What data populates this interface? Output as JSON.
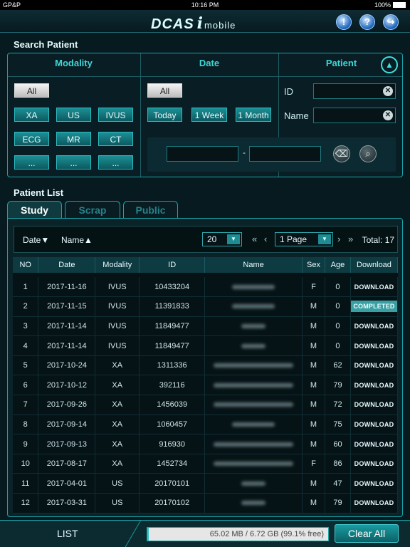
{
  "status": {
    "carrier": "GP&P",
    "time": "10:16 PM",
    "battery": "100%"
  },
  "header": {
    "logo": "DCAS",
    "logo_i": "i",
    "logo_mobile": "mobile",
    "buttons": [
      {
        "icon": "alert-icon",
        "glyph": "!"
      },
      {
        "icon": "help-icon",
        "glyph": "?"
      },
      {
        "icon": "logout-icon",
        "glyph": "↪"
      }
    ]
  },
  "search": {
    "title": "Search Patient",
    "modality": {
      "header": "Modality",
      "all": "All",
      "buttons": [
        "XA",
        "US",
        "IVUS",
        "ECG",
        "MR",
        "CT",
        "...",
        "...",
        "..."
      ]
    },
    "date": {
      "header": "Date",
      "all": "All",
      "buttons": [
        "Today",
        "1 Week",
        "1 Month"
      ],
      "range_sep": "-",
      "range_from": "",
      "range_to": ""
    },
    "patient": {
      "header": "Patient",
      "id_label": "ID",
      "name_label": "Name",
      "id_value": "",
      "name_value": ""
    }
  },
  "list": {
    "title": "Patient List",
    "tabs": [
      "Study",
      "Scrap",
      "Public"
    ],
    "sort_date": "Date▼",
    "sort_name": "Name▲",
    "page_size": "20",
    "page": "1 Page",
    "total": "Total: 17",
    "columns": [
      "NO",
      "Date",
      "Modality",
      "ID",
      "Name",
      "Sex",
      "Age",
      "Download"
    ],
    "rows": [
      {
        "no": "1",
        "date": "2017-11-16",
        "modality": "IVUS",
        "id": "10433204",
        "sex": "F",
        "age": "0",
        "download": "DOWNLOAD"
      },
      {
        "no": "2",
        "date": "2017-11-15",
        "modality": "IVUS",
        "id": "11391833",
        "sex": "M",
        "age": "0",
        "download": "COMPLETED"
      },
      {
        "no": "3",
        "date": "2017-11-14",
        "modality": "IVUS",
        "id": "11849477",
        "sex": "M",
        "age": "0",
        "download": "DOWNLOAD"
      },
      {
        "no": "4",
        "date": "2017-11-14",
        "modality": "IVUS",
        "id": "11849477",
        "sex": "M",
        "age": "0",
        "download": "DOWNLOAD"
      },
      {
        "no": "5",
        "date": "2017-10-24",
        "modality": "XA",
        "id": "1311336",
        "sex": "M",
        "age": "62",
        "download": "DOWNLOAD"
      },
      {
        "no": "6",
        "date": "2017-10-12",
        "modality": "XA",
        "id": "392116",
        "sex": "M",
        "age": "79",
        "download": "DOWNLOAD"
      },
      {
        "no": "7",
        "date": "2017-09-26",
        "modality": "XA",
        "id": "1456039",
        "sex": "M",
        "age": "72",
        "download": "DOWNLOAD"
      },
      {
        "no": "8",
        "date": "2017-09-14",
        "modality": "XA",
        "id": "1060457",
        "sex": "M",
        "age": "75",
        "download": "DOWNLOAD"
      },
      {
        "no": "9",
        "date": "2017-09-13",
        "modality": "XA",
        "id": "916930",
        "sex": "M",
        "age": "60",
        "download": "DOWNLOAD"
      },
      {
        "no": "10",
        "date": "2017-08-17",
        "modality": "XA",
        "id": "1452734",
        "sex": "F",
        "age": "86",
        "download": "DOWNLOAD"
      },
      {
        "no": "11",
        "date": "2017-04-01",
        "modality": "US",
        "id": "20170101",
        "sex": "M",
        "age": "47",
        "download": "DOWNLOAD"
      },
      {
        "no": "12",
        "date": "2017-03-31",
        "modality": "US",
        "id": "20170102",
        "sex": "M",
        "age": "79",
        "download": "DOWNLOAD"
      }
    ]
  },
  "footer": {
    "list_label": "LIST",
    "storage": "65.02 MB / 6.72 GB (99.1% free)",
    "used_fraction": 0.009,
    "clear_all": "Clear All"
  },
  "colors": {
    "accent": "#1aa3a8",
    "header_text": "#3fd7d8",
    "completed_bg": "#3a9fa3"
  }
}
